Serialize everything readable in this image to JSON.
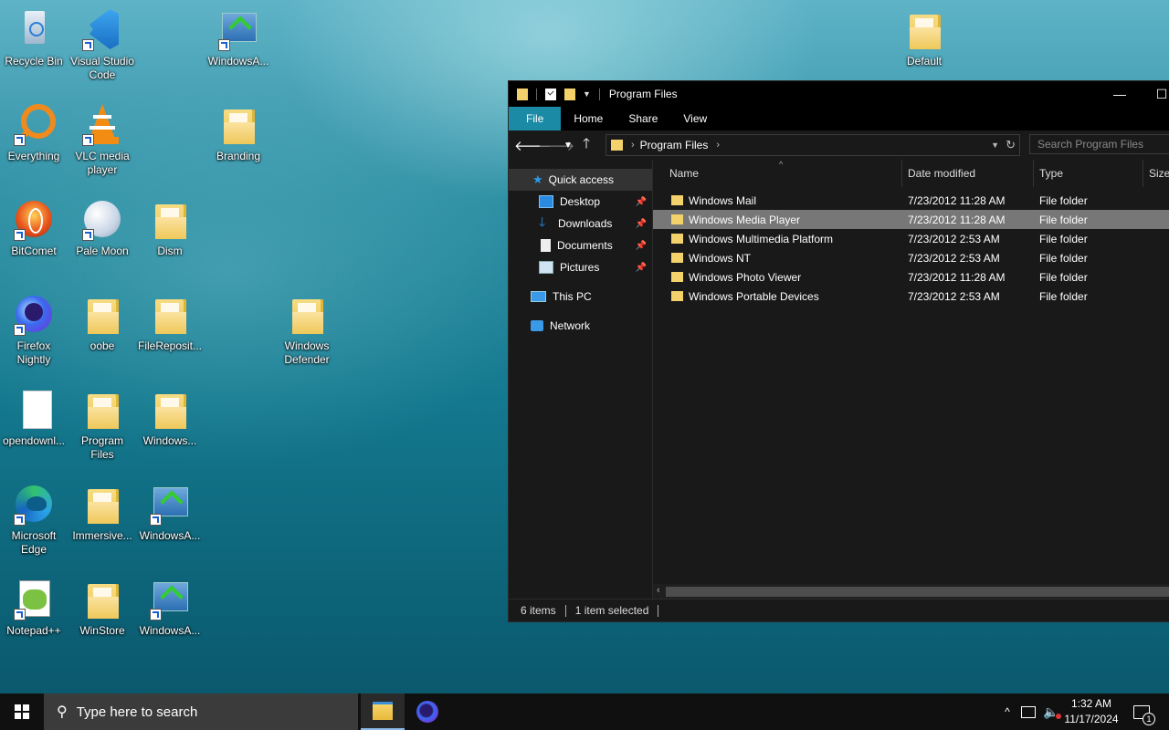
{
  "desktop": {
    "icons": [
      {
        "label": "Recycle Bin",
        "icon": "recycle-bin-icon"
      },
      {
        "label": "Visual Studio Code",
        "icon": "vscode-icon"
      },
      {
        "label": "WindowsA...",
        "icon": "shortcut-app-icon"
      },
      {
        "label": "Default",
        "icon": "folder-icon"
      },
      {
        "label": "Everything",
        "icon": "everything-icon"
      },
      {
        "label": "VLC media player",
        "icon": "vlc-icon"
      },
      {
        "label": "Branding",
        "icon": "folder-icon"
      },
      {
        "label": "BitComet",
        "icon": "bitcomet-icon"
      },
      {
        "label": "Pale Moon",
        "icon": "pale-moon-icon"
      },
      {
        "label": "Dism",
        "icon": "folder-icon"
      },
      {
        "label": "Firefox Nightly",
        "icon": "firefox-nightly-icon"
      },
      {
        "label": "oobe",
        "icon": "folder-icon"
      },
      {
        "label": "FileReposit...",
        "icon": "folder-icon"
      },
      {
        "label": "Windows Defender",
        "icon": "folder-icon"
      },
      {
        "label": "opendownl...",
        "icon": "file-icon"
      },
      {
        "label": "Program Files",
        "icon": "folder-icon"
      },
      {
        "label": "Windows...",
        "icon": "folder-icon"
      },
      {
        "label": "Microsoft Edge",
        "icon": "edge-icon"
      },
      {
        "label": "Immersive...",
        "icon": "folder-icon"
      },
      {
        "label": "WindowsA...",
        "icon": "shortcut-app-icon"
      },
      {
        "label": "Notepad++",
        "icon": "notepadpp-icon"
      },
      {
        "label": "WinStore",
        "icon": "folder-icon"
      },
      {
        "label": "WindowsA...",
        "icon": "shortcut-app-icon"
      }
    ]
  },
  "explorer": {
    "title": "Program Files",
    "window_controls": {
      "minimize": "—",
      "maximize": "☐"
    },
    "ribbon_tabs": [
      "File",
      "Home",
      "Share",
      "View"
    ],
    "address": {
      "crumb": "Program Files"
    },
    "search_placeholder": "Search Program Files",
    "nav": {
      "quick_access": "Quick access",
      "pinned": [
        "Desktop",
        "Downloads",
        "Documents",
        "Pictures"
      ],
      "this_pc": "This PC",
      "network": "Network"
    },
    "columns": {
      "name": "Name",
      "date": "Date modified",
      "type": "Type",
      "size": "Size"
    },
    "files": [
      {
        "name": "Windows Mail",
        "date": "7/23/2012 11:28 AM",
        "type": "File folder",
        "selected": false
      },
      {
        "name": "Windows Media Player",
        "date": "7/23/2012 11:28 AM",
        "type": "File folder",
        "selected": true
      },
      {
        "name": "Windows Multimedia Platform",
        "date": "7/23/2012 2:53 AM",
        "type": "File folder",
        "selected": false
      },
      {
        "name": "Windows NT",
        "date": "7/23/2012 2:53 AM",
        "type": "File folder",
        "selected": false
      },
      {
        "name": "Windows Photo Viewer",
        "date": "7/23/2012 11:28 AM",
        "type": "File folder",
        "selected": false
      },
      {
        "name": "Windows Portable Devices",
        "date": "7/23/2012 2:53 AM",
        "type": "File folder",
        "selected": false
      }
    ],
    "status": {
      "count": "6 items",
      "selected": "1 item selected"
    }
  },
  "taskbar": {
    "search_placeholder": "Type here to search",
    "pinned": [
      "file-explorer-icon",
      "firefox-icon"
    ],
    "clock": {
      "time": "1:32 AM",
      "date": "11/17/2024"
    },
    "notification_count": "1"
  },
  "colors": {
    "accent": "#1a8aa5",
    "explorer_bg": "#191919",
    "taskbar_bg": "#101010",
    "folder": "#f3d16b"
  }
}
